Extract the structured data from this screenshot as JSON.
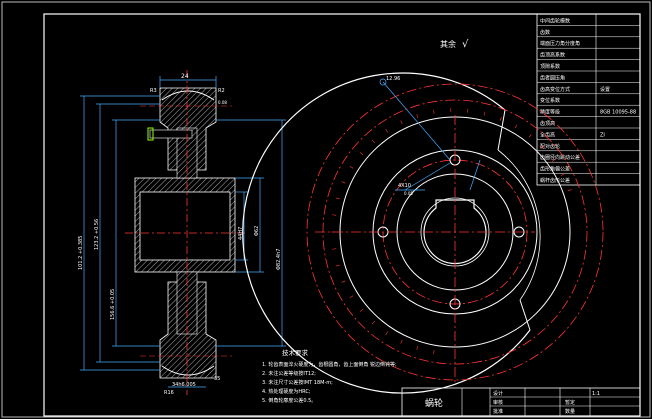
{
  "roughness_note": "其余",
  "roughness_symbol": "√",
  "params": [
    {
      "label": "中间齿轮模数",
      "value": ""
    },
    {
      "label": "齿数",
      "value": ""
    },
    {
      "label": "端面压力角分度角",
      "value": ""
    },
    {
      "label": "齿顶高系数",
      "value": ""
    },
    {
      "label": "顶隙系数",
      "value": ""
    },
    {
      "label": "齿者圆压角",
      "value": ""
    },
    {
      "label": "齿高变位方式",
      "value": "设置"
    },
    {
      "label": "变位系数",
      "value": ""
    },
    {
      "label": "精度等级",
      "value": "8GB 10095-88"
    },
    {
      "label": "齿顶高",
      "value": ""
    },
    {
      "label": "全齿高",
      "value": "ZI"
    },
    {
      "label": "配对齿轮",
      "value": ""
    },
    {
      "label": "齿圈径向跳动公差",
      "value": ""
    },
    {
      "label": "齿形角偏公差",
      "value": ""
    },
    {
      "label": "蜗杆齿形公差",
      "value": ""
    }
  ],
  "side_dims": [
    "24",
    "R3",
    "R2",
    "0.08",
    "35",
    "34h6.005",
    "R16"
  ],
  "side_vertical_dims": [
    "101.2 +0.385",
    "123.2 +0.56",
    "156.6 +0.05",
    "44H7",
    "Φ62",
    "Φ82.4h7"
  ],
  "front_dims": [
    "12.96",
    "4X10",
    "0.05"
  ],
  "tech_title": "技术要求",
  "tech_notes": [
    "1. 轮齿表面淬火硬度为，齿根圆角，齿上面倒角 锐边倒钝等;",
    "2. 未注公差等级按IT12;",
    "3. 未注尺寸公差按IMT 18M-m;",
    "4. 热处理硬度为HRC;",
    "5. 倒角轮廓度公差0.5。"
  ],
  "title_block": {
    "part_name": "蜗轮",
    "scale": "1:1",
    "material": "",
    "row_labels": [
      "设计",
      "审核",
      "批准"
    ],
    "row_values": [
      "",
      "暂定",
      "数量"
    ]
  }
}
